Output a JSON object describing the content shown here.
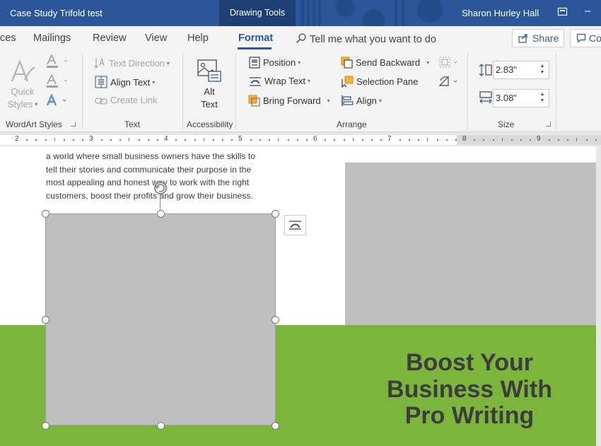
{
  "window": {
    "doc_title": "Case Study Trifold test",
    "context_tab": "Drawing Tools",
    "user_name": "Sharon Hurley Hall",
    "minimize_glyph": "–"
  },
  "tabs": {
    "references": "ces",
    "mailings": "Mailings",
    "review": "Review",
    "view": "View",
    "help": "Help",
    "format": "Format",
    "tell_me": "Tell me what you want to do",
    "share": "Share",
    "comments": "Co"
  },
  "ribbon": {
    "wordart": {
      "quick_styles_line1": "Quick",
      "quick_styles_line2": "Styles",
      "label": "WordArt Styles"
    },
    "text": {
      "text_direction": "Text Direction",
      "align_text": "Align Text",
      "create_link": "Create Link",
      "label": "Text"
    },
    "accessibility": {
      "alt_text_line1": "Alt",
      "alt_text_line2": "Text",
      "label": "Accessibility"
    },
    "arrange": {
      "position": "Position",
      "wrap_text": "Wrap Text",
      "bring_forward": "Bring Forward",
      "send_backward": "Send Backward",
      "selection_pane": "Selection Pane",
      "align": "Align",
      "label": "Arrange"
    },
    "size": {
      "height": "2.83\"",
      "width": "3.08\"",
      "label": "Size"
    }
  },
  "ruler": {
    "numbers": [
      "2",
      "3",
      "4",
      "5",
      "6",
      "7",
      "8",
      "9"
    ]
  },
  "document": {
    "body_lines": [
      "a world where small business owners have the skills to",
      "tell their stories and communicate their purpose in the",
      "most appealing and honest way to work with the right",
      "customers, boost their profits and grow their business."
    ],
    "headline_lines": [
      "Boost Your",
      "Business With",
      "Pro Writing"
    ]
  },
  "colors": {
    "title_bar": "#2b579a",
    "accent": "#2b579a",
    "green_band": "#7cb53c",
    "placeholder_gray": "#bfbfbf",
    "headline_text": "#3d3d3d"
  },
  "icons": [
    "ribbon-display-options-icon",
    "search-icon",
    "share-icon",
    "comment-icon",
    "quick-styles-icon",
    "text-fill-icon",
    "text-outline-icon",
    "text-effects-icon",
    "text-direction-icon",
    "align-text-icon",
    "create-link-icon",
    "alt-text-icon",
    "position-icon",
    "wrap-text-icon",
    "bring-forward-icon",
    "send-backward-icon",
    "selection-pane-icon",
    "align-icon",
    "group-icon",
    "rotate-icon",
    "height-icon",
    "width-icon",
    "rotate-handle-icon",
    "layout-options-icon"
  ]
}
